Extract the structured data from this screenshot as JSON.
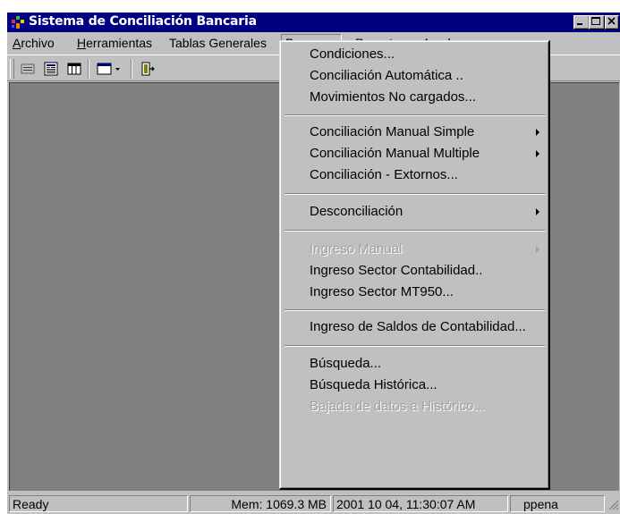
{
  "window": {
    "title": "Sistema de Conciliación Bancaria"
  },
  "menubar": {
    "archivo": {
      "mnemonic": "A",
      "rest": "rchivo"
    },
    "herramientas": {
      "mnemonic": "H",
      "rest": "erramientas"
    },
    "tablas": "Tablas Generales",
    "procesos": "Procesos",
    "reportes": "Reportes",
    "ayuda": {
      "mnemonic": "A",
      "rest": "yuda"
    }
  },
  "procesos_menu": {
    "condiciones": "Condiciones...",
    "conciliacion_automatica": "Conciliación Automática ..",
    "movimientos_no_cargados": "Movimientos No cargados...",
    "conciliacion_manual_simple": "Conciliación Manual Simple",
    "conciliacion_manual_multiple": "Conciliación Manual Multiple",
    "conciliacion_extornos": "Conciliación - Extornos...",
    "desconciliacion": "Desconciliación",
    "ingreso_manual": "Ingreso Manual",
    "ingreso_sector_contabilidad": "Ingreso Sector Contabilidad..",
    "ingreso_sector_mt950": "Ingreso Sector MT950...",
    "ingreso_saldos": "Ingreso de Saldos de Contabilidad...",
    "busqueda": "Búsqueda...",
    "busqueda_historica": "Búsqueda Histórica...",
    "bajada_datos": "Bajada de datos a Histórico..."
  },
  "statusbar": {
    "status": "Ready",
    "memory": "Mem: 1069.3 MB",
    "datetime": "2001 10 04, 11:30:07 AM",
    "user": "ppena"
  },
  "colors": {
    "titlebar": "#000080",
    "face": "#c0c0c0",
    "client": "#808080",
    "disabled_text": "#a0a0a0"
  },
  "icons": [
    "app-icon",
    "minimize-icon",
    "maximize-icon",
    "close-icon",
    "form-icon",
    "report-icon",
    "table-icon",
    "window-icon",
    "exit-icon",
    "submenu-arrow-icon"
  ]
}
